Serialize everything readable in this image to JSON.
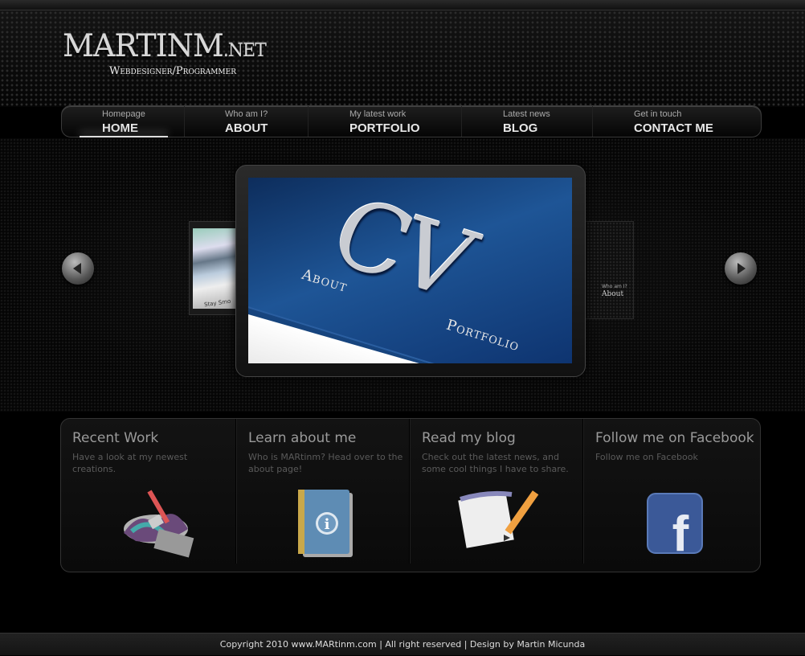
{
  "logo": {
    "name": "MARTINM",
    "tld": ".NET",
    "tagline": "Webdesigner/Programmer"
  },
  "nav": [
    {
      "sub": "Homepage",
      "label": "HOME"
    },
    {
      "sub": "Who am I?",
      "label": "ABOUT"
    },
    {
      "sub": "My latest work",
      "label": "PORTFOLIO"
    },
    {
      "sub": "Latest news",
      "label": "BLOG"
    },
    {
      "sub": "Get in touch",
      "label": "CONTACT ME"
    }
  ],
  "slider": {
    "main": {
      "big": "CV",
      "link1": "About",
      "link2": "Portfolio"
    },
    "left_caption": "Stay Smo",
    "right": {
      "small": "Who am I?",
      "label": "About"
    }
  },
  "boxes": [
    {
      "title": "Recent Work",
      "text": "Have a look at my newest creations."
    },
    {
      "title": "Learn about me",
      "text": "Who is MARtinm? Head over to the about page!"
    },
    {
      "title": "Read my blog",
      "text": "Check out the latest news, and some cool things I have to share."
    },
    {
      "title": "Follow me on Facebook",
      "text": "Follow me on Facebook"
    }
  ],
  "footer": {
    "text": "Copyright 2010 www.MARtinm.com | All right reserved | Design by Martin Micunda"
  },
  "colors": {
    "background": "#000000",
    "facebook": "#3b5998",
    "slide_blue": "#1e5596"
  }
}
